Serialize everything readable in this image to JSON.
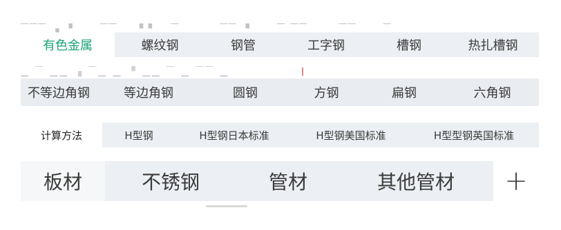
{
  "tab_bar_1": {
    "tabs": [
      "有色金属",
      "螺纹钢",
      "钢管",
      "工字钢",
      "槽钢",
      "热扎槽钢"
    ],
    "active_index": 0
  },
  "tab_bar_2": {
    "tabs": [
      "不等边角钢",
      "等边角钢",
      "圆钢",
      "方钢",
      "扁钢",
      "六角钢"
    ]
  },
  "tab_bar_3": {
    "tabs": [
      "计算方法",
      "H型钢",
      "H型钢日本标准",
      "H型钢美国标准",
      "H型型钢英国标准"
    ],
    "active_index": 0
  },
  "tab_bar_4": {
    "tabs": [
      "板材",
      "不锈钢",
      "管材",
      "其他管材"
    ],
    "active_index": 0,
    "add_label": "+"
  },
  "colors": {
    "active_tab_text": "#1aa37a",
    "bar_background": "#eceff3"
  },
  "icons": {
    "add": "plus-icon"
  }
}
